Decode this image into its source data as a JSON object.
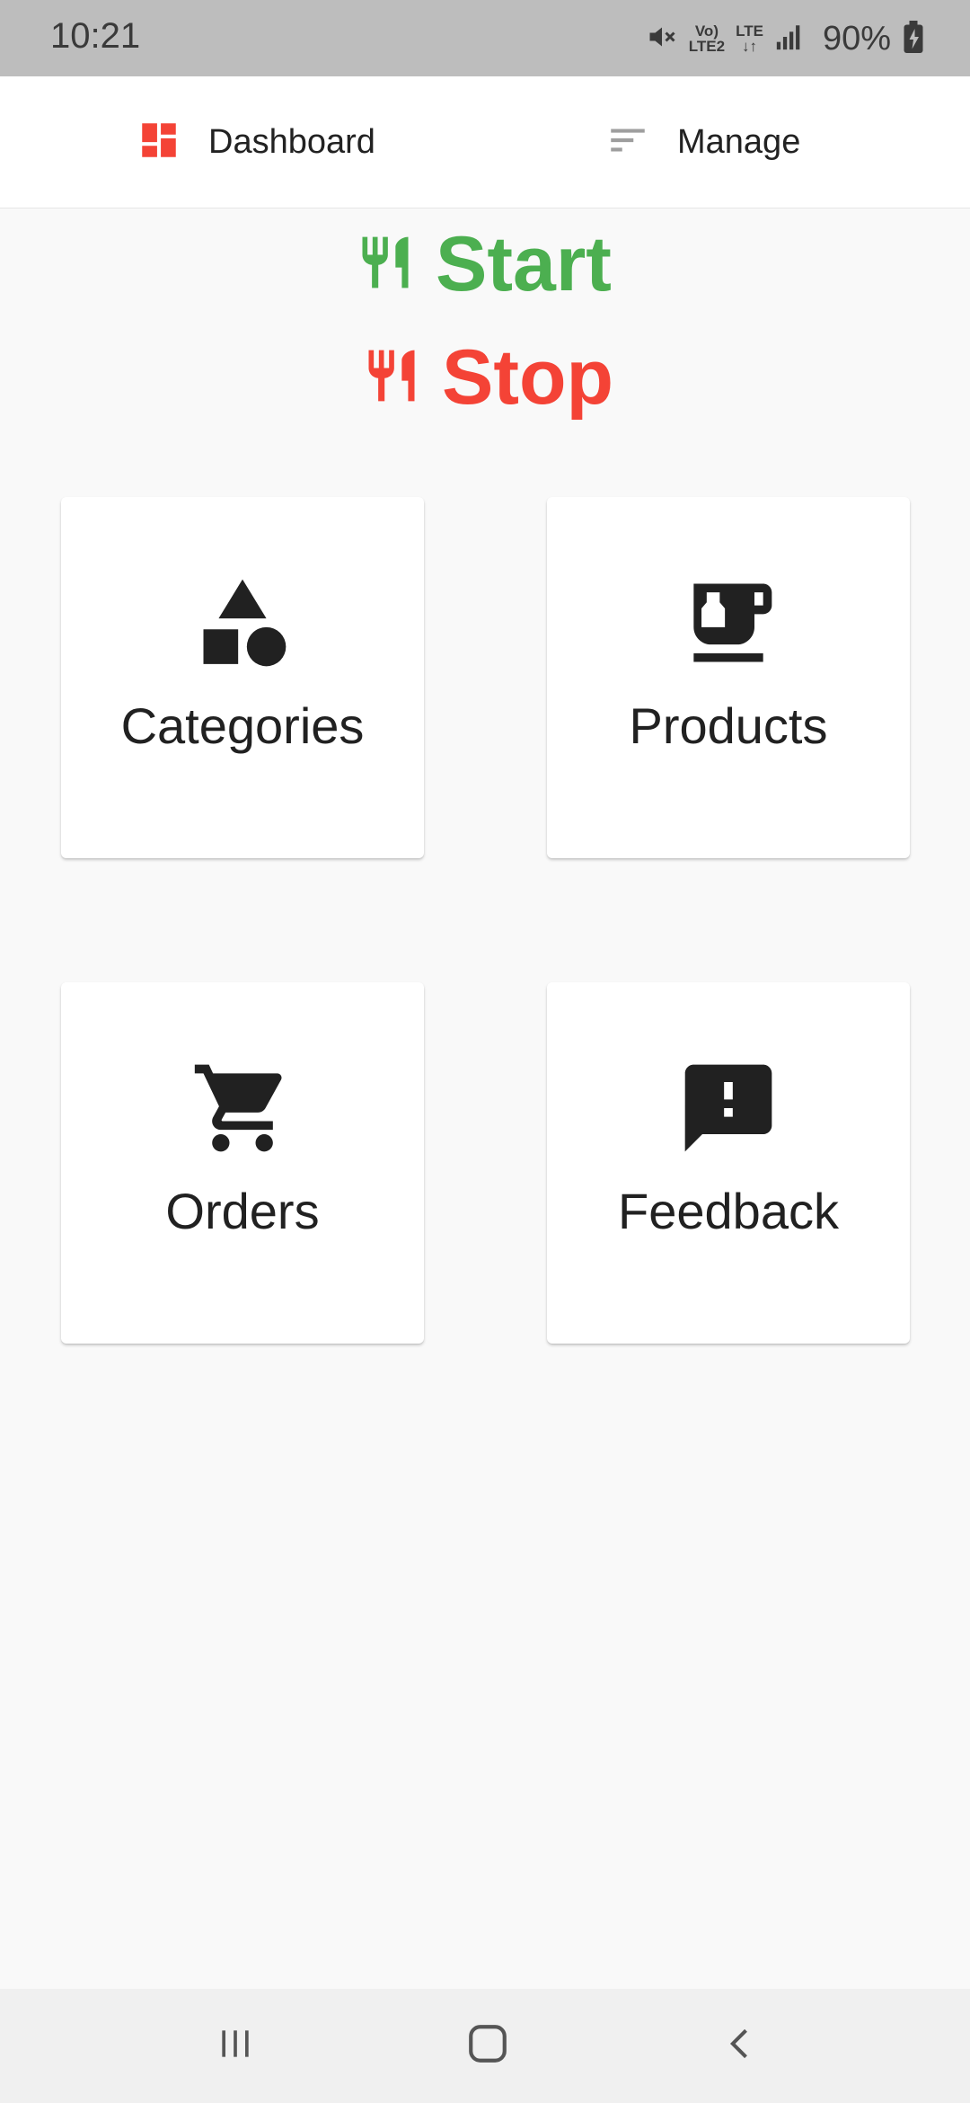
{
  "status_bar": {
    "time": "10:21",
    "volte": "Vo)",
    "lte2": "LTE2",
    "lte": "LTE",
    "battery": "90%"
  },
  "top_nav": {
    "dashboard_label": "Dashboard",
    "manage_label": "Manage",
    "dashboard_icon": "dashboard-icon",
    "manage_icon": "sort-icon"
  },
  "service": {
    "start_label": "Start",
    "stop_label": "Stop",
    "start_color": "#4caf50",
    "stop_color": "#f44336"
  },
  "cards": {
    "categories": "Categories",
    "products": "Products",
    "orders": "Orders",
    "feedback": "Feedback"
  },
  "colors": {
    "accent": "#f44336",
    "icon": "#212121"
  }
}
